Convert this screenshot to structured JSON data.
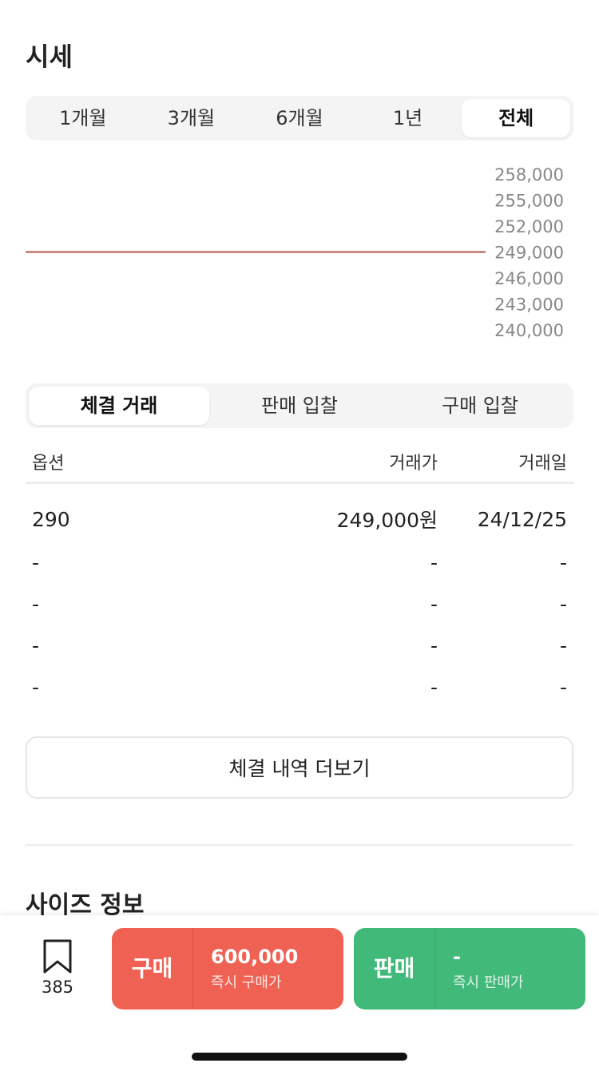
{
  "section_title": "시세",
  "period_tabs": [
    {
      "label": "1개월",
      "active": false
    },
    {
      "label": "3개월",
      "active": false
    },
    {
      "label": "6개월",
      "active": false
    },
    {
      "label": "1년",
      "active": false
    },
    {
      "label": "전체",
      "active": true
    }
  ],
  "chart_data": {
    "type": "line",
    "y_ticks": [
      "258,000",
      "255,000",
      "252,000",
      "249,000",
      "246,000",
      "243,000",
      "240,000"
    ],
    "ylim": [
      240000,
      258000
    ],
    "series": [
      {
        "values": [
          249000,
          249000
        ]
      }
    ],
    "line_color": "#b5534a"
  },
  "trade_tabs": [
    {
      "label": "체결 거래",
      "active": true
    },
    {
      "label": "판매 입찰",
      "active": false
    },
    {
      "label": "구매 입찰",
      "active": false
    }
  ],
  "table": {
    "headers": {
      "option": "옵션",
      "price": "거래가",
      "date": "거래일"
    },
    "rows": [
      {
        "option": "290",
        "price": "249,000원",
        "date": "24/12/25"
      },
      {
        "option": "-",
        "price": "-",
        "date": "-"
      },
      {
        "option": "-",
        "price": "-",
        "date": "-"
      },
      {
        "option": "-",
        "price": "-",
        "date": "-"
      },
      {
        "option": "-",
        "price": "-",
        "date": "-"
      }
    ]
  },
  "more_button": "체결 내역 더보기",
  "size_title": "사이즈 정보",
  "bottom_bar": {
    "bookmark_icon": "bookmark-icon",
    "bookmark_count": "385",
    "buy": {
      "label": "구매",
      "price": "600,000",
      "sub": "즉시 구매가",
      "color": "#ef6253"
    },
    "sell": {
      "label": "판매",
      "price": "-",
      "sub": "즉시 판매가",
      "color": "#41b979"
    }
  }
}
